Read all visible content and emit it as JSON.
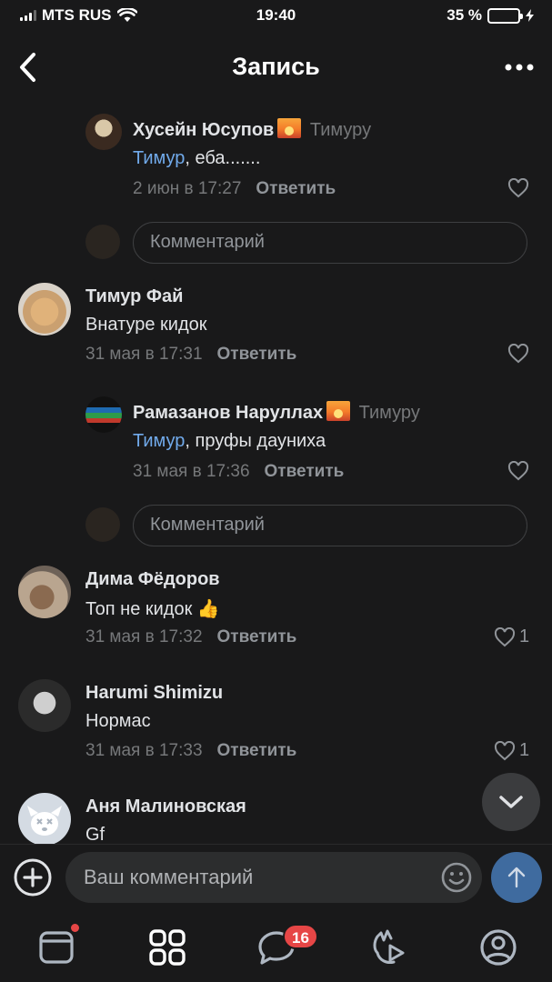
{
  "status_bar": {
    "carrier": "MTS RUS",
    "time": "19:40",
    "battery": "35 %",
    "battery_level": 0.35
  },
  "header": {
    "title": "Запись"
  },
  "comments": [
    {
      "author": "Хусейн Юсупов",
      "reply_to": "Тимуру",
      "mention": "Тимур",
      "text": ", еба.......",
      "date": "2 июн в 17:27",
      "reply_label": "Ответить",
      "likes": ""
    },
    {
      "author": "Тимур Фай",
      "reply_to": "",
      "mention": "",
      "text": "Внатуре кидок",
      "date": "31 мая в 17:31",
      "reply_label": "Ответить",
      "likes": ""
    },
    {
      "author": "Рамазанов Наруллах",
      "reply_to": "Тимуру",
      "mention": "Тимур",
      "text": ", пруфы дауниха",
      "date": "31 мая в 17:36",
      "reply_label": "Ответить",
      "likes": ""
    },
    {
      "author": "Дима Фёдоров",
      "reply_to": "",
      "mention": "",
      "text": "Топ не кидок 👍",
      "date": "31 мая в 17:32",
      "reply_label": "Ответить",
      "likes": "1"
    },
    {
      "author": "Harumi Shimizu",
      "reply_to": "",
      "mention": "",
      "text": "Нормас",
      "date": "31 мая в 17:33",
      "reply_label": "Ответить",
      "likes": "1"
    },
    {
      "author": "Аня Малиновская",
      "reply_to": "",
      "mention": "",
      "text": "Gf",
      "date": "",
      "reply_label": "",
      "likes": ""
    }
  ],
  "thread_reply_box": {
    "placeholder": "Комментарий"
  },
  "comment_input": {
    "placeholder": "Ваш комментарий"
  },
  "tabbar": {
    "messages_badge": "16"
  },
  "colors": {
    "background": "#19191a",
    "accent": "#71aaeb",
    "badge": "#e64646",
    "send": "#3f6b9f"
  }
}
